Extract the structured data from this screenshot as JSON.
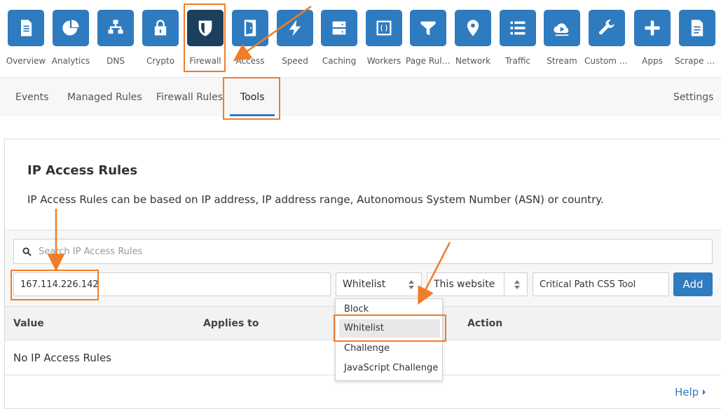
{
  "nav": {
    "items": [
      {
        "label": "Overview",
        "icon": "document-icon"
      },
      {
        "label": "Analytics",
        "icon": "pie-chart-icon"
      },
      {
        "label": "DNS",
        "icon": "network-tree-icon"
      },
      {
        "label": "Crypto",
        "icon": "lock-icon"
      },
      {
        "label": "Firewall",
        "icon": "shield-icon",
        "active": true
      },
      {
        "label": "Access",
        "icon": "door-icon"
      },
      {
        "label": "Speed",
        "icon": "lightning-icon"
      },
      {
        "label": "Caching",
        "icon": "server-icon"
      },
      {
        "label": "Workers",
        "icon": "code-braces-icon"
      },
      {
        "label": "Page Rules",
        "icon": "filter-icon"
      },
      {
        "label": "Network",
        "icon": "location-pin-icon"
      },
      {
        "label": "Traffic",
        "icon": "list-icon"
      },
      {
        "label": "Stream",
        "icon": "cloud-play-icon"
      },
      {
        "label": "Custom P...",
        "icon": "wrench-icon"
      },
      {
        "label": "Apps",
        "icon": "plus-icon"
      },
      {
        "label": "Scrape Shi...",
        "icon": "document-lines-icon"
      }
    ]
  },
  "subtabs": {
    "events": "Events",
    "managed_rules": "Managed Rules",
    "firewall_rules": "Firewall Rules",
    "tools": "Tools",
    "settings": "Settings"
  },
  "card": {
    "title": "IP Access Rules",
    "description": "IP Access Rules can be based on IP address, IP address range, Autonomous System Number (ASN) or country."
  },
  "controls": {
    "search_placeholder": "Search IP Access Rules",
    "ip_value": "167.114.226.142",
    "action_selected": "Whitelist",
    "scope_selected": "This website",
    "note_value": "Critical Path CSS Tool",
    "add_label": "Add"
  },
  "dropdown": {
    "options": [
      "Block",
      "Whitelist",
      "Challenge",
      "JavaScript Challenge"
    ],
    "selected": "Whitelist"
  },
  "table": {
    "col_value": "Value",
    "col_applies_to": "Applies to",
    "col_action": "Action",
    "empty_text": "No IP Access Rules"
  },
  "footer": {
    "help": "Help"
  },
  "colors": {
    "tile_blue": "#2f7bbf",
    "tile_active": "#1d3f5e",
    "annotation_orange": "#f07d2a"
  }
}
